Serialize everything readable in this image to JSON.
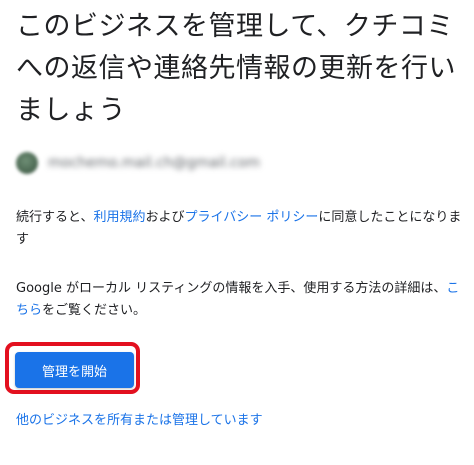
{
  "header": {
    "title": "このビジネスを管理して、クチコミへの返信や連絡先情報の更新を行いましょう"
  },
  "account": {
    "email": "mochemo.mail.ch@gmail.com"
  },
  "terms": {
    "prefix": "続行すると、",
    "terms_link": "利用規約",
    "and_text": "および",
    "privacy_link": "プライバシー ポリシー",
    "suffix": "に同意したことになります"
  },
  "info": {
    "text": "Google がローカル リスティングの情報を入手、使用する方法の詳細は、",
    "link": "こちら",
    "suffix": "をご覧ください。"
  },
  "actions": {
    "start_button": "管理を開始",
    "other_link": "他のビジネスを所有または管理しています"
  },
  "colors": {
    "accent": "#1a73e8",
    "highlight_frame": "#e3101f",
    "text": "#202124"
  }
}
